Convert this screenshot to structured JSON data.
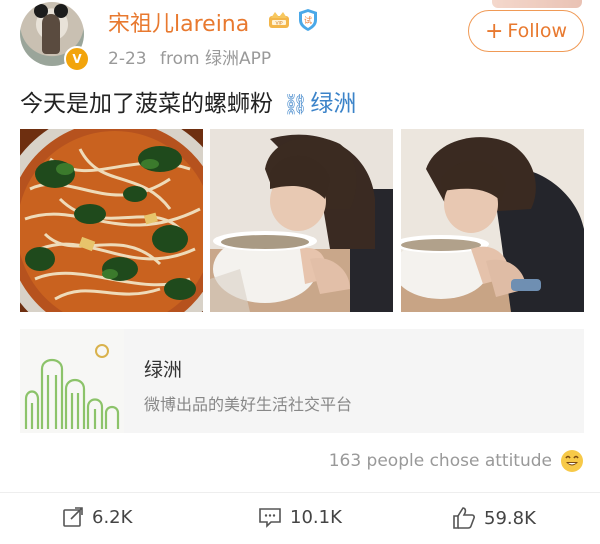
{
  "post": {
    "author": {
      "name": "宋祖儿lareina",
      "verified_badge": "V"
    },
    "meta": {
      "date": "2-23",
      "source": "from 绿洲APP"
    },
    "follow_label": "Follow",
    "text": "今天是加了菠菜的螺蛳粉",
    "link_label": "绿洲",
    "photos": [
      {
        "alt": "spinach river snail noodles"
      },
      {
        "alt": "woman sipping soup bowl"
      },
      {
        "alt": "woman sipping soup bowl close"
      }
    ],
    "card": {
      "title": "绿洲",
      "subtitle": "微博出品的美好生活社交平台"
    },
    "attitude_text": "163 people chose attitude",
    "actions": {
      "share": "6.2K",
      "comment": "10.1K",
      "like": "59.8K"
    }
  },
  "colors": {
    "username": "#e8792f",
    "link": "#3b83c9",
    "follow_border": "#f09a56",
    "card_bg": "#f5f5f5",
    "oasis_green": "#8cc36a",
    "oasis_yellow": "#d9b24c"
  },
  "icons": [
    "crown-icon",
    "shield-icon",
    "link-icon",
    "smile-icon",
    "share-icon",
    "comment-icon",
    "like-icon"
  ]
}
